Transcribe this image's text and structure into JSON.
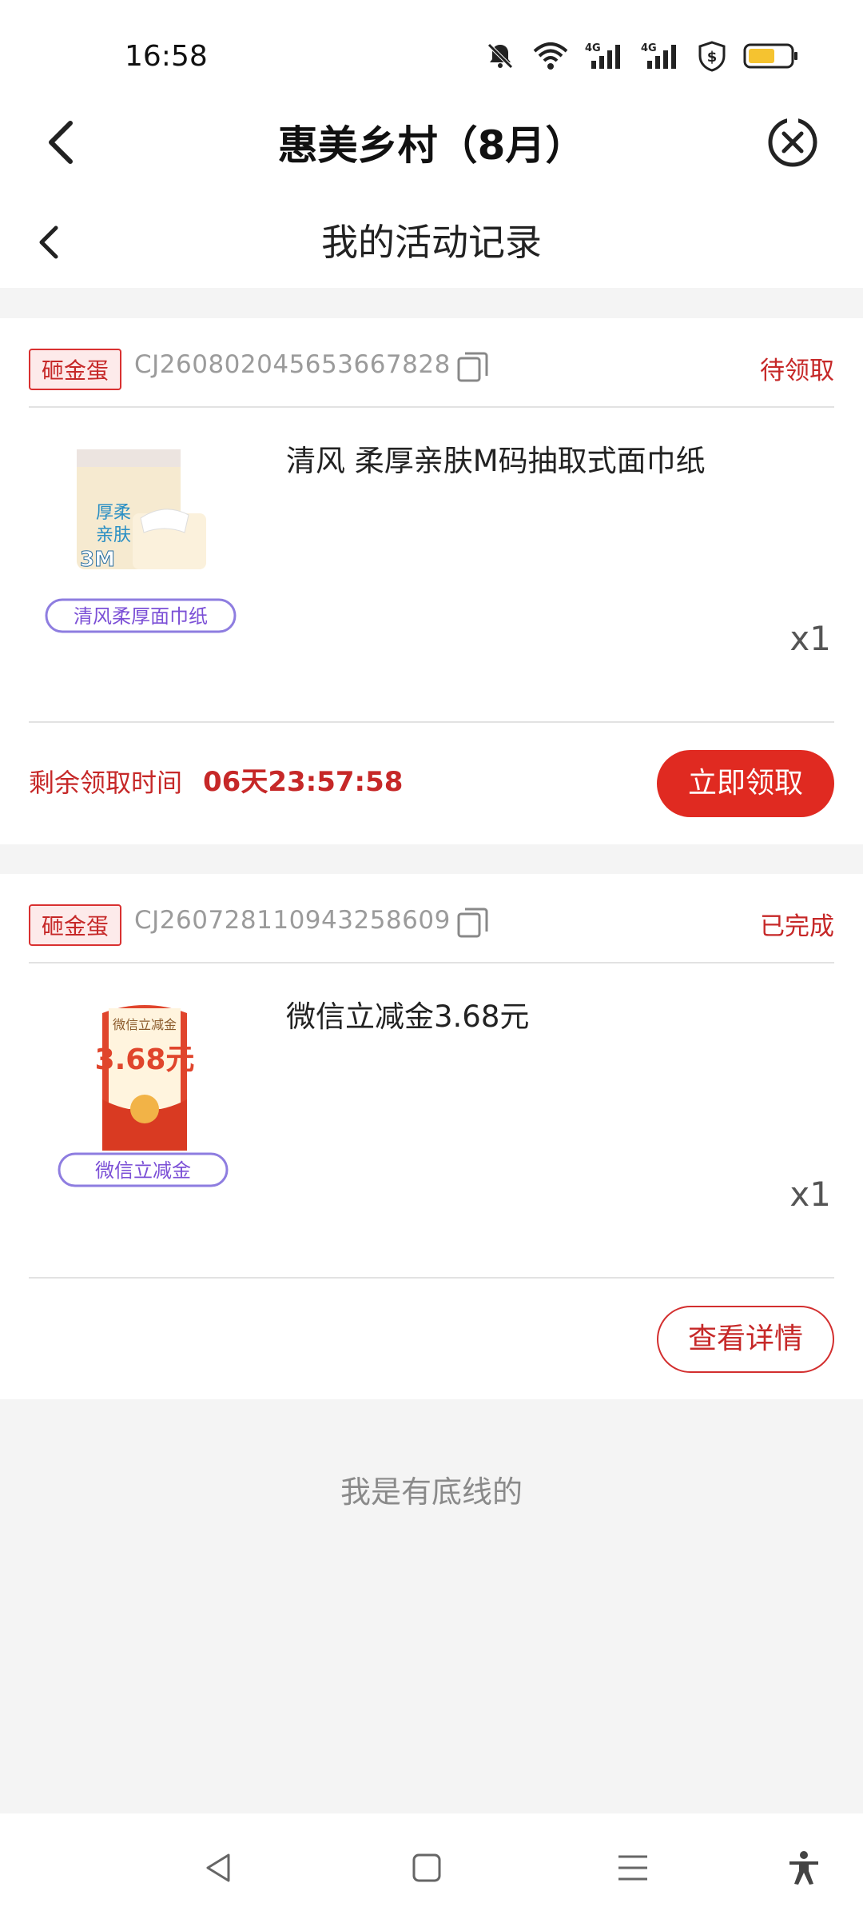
{
  "status_bar": {
    "time": "16:58",
    "net1": "4G",
    "net2": "4G"
  },
  "app": {
    "title": "惠美乡村（8月）"
  },
  "subheader": {
    "title": "我的活动记录"
  },
  "records": [
    {
      "tag": "砸金蛋",
      "order_no": "CJ260802045653667828",
      "status": "待领取",
      "product_name": "清风 柔厚亲肤M码抽取式面巾纸",
      "image_caption": "清风柔厚面巾纸",
      "image_text_1": "厚柔",
      "image_text_2": "亲肤",
      "image_text_3": "3M",
      "qty": "x1",
      "countdown_label": "剩余领取时间",
      "countdown": "06天23:57:58",
      "action": "立即领取"
    },
    {
      "tag": "砸金蛋",
      "order_no": "CJ260728110943258609",
      "status": "已完成",
      "product_name": "微信立减金3.68元",
      "image_caption": "微信立减金",
      "image_text_1": "微信立减金",
      "image_text_2": "3.68元",
      "qty": "x1",
      "action": "查看详情"
    }
  ],
  "footer": {
    "note": "我是有底线的"
  },
  "colors": {
    "accent": "#e02a21",
    "status_red": "#c62828"
  }
}
